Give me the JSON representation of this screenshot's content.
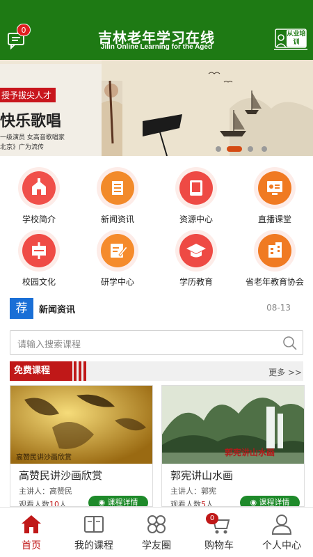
{
  "header": {
    "title": "吉林老年学习在线",
    "subtitle": "Jilin Online Learning for the Aged",
    "message_count": "0",
    "train_label": "从业培训",
    "bg_color": "#1e7a14"
  },
  "banner": {
    "tag": "授予拔尖人才",
    "headline": "快乐歌唱",
    "sub_line_1": "一级演员 女高音歌唱家",
    "sub_line_2": "北京》广为流传",
    "slide_count": 4,
    "active_slide": 2
  },
  "features": [
    {
      "label": "学校简介",
      "icon": "school-icon",
      "color": "#f0504a"
    },
    {
      "label": "新闻资讯",
      "icon": "news-icon",
      "color": "#f28a2a"
    },
    {
      "label": "资源中心",
      "icon": "book-icon",
      "color": "#ee4a44"
    },
    {
      "label": "直播课堂",
      "icon": "live-class-icon",
      "color": "#f07a22"
    },
    {
      "label": "校园文化",
      "icon": "culture-icon",
      "color": "#ef4b45"
    },
    {
      "label": "研学中心",
      "icon": "study-edit-icon",
      "color": "#f58b2c"
    },
    {
      "label": "学历教育",
      "icon": "graduation-cap-icon",
      "color": "#ee4a44"
    },
    {
      "label": "省老年教育协会",
      "icon": "building-icon",
      "color": "#f07a22"
    }
  ],
  "news": {
    "badge": "荐",
    "title": "新闻资讯",
    "date": "08-13"
  },
  "search": {
    "placeholder": "请输入搜索课程"
  },
  "free_courses": {
    "label": "免费课程",
    "more": "更多 >>",
    "courses": [
      {
        "title": "高赞民讲沙画欣赏",
        "lecturer": "主讲人：高赞民",
        "views_label": "观看人数",
        "views": "10",
        "views_unit": "人",
        "button": "课程详情",
        "image_caption": "高赞民讲沙画欣赏"
      },
      {
        "title": "郭宪讲山水画",
        "lecturer": "主讲人：郭宪",
        "views_label": "观看人数",
        "views": "5",
        "views_unit": "人",
        "button": "课程详情",
        "image_caption": "郭宪讲山水画"
      }
    ]
  },
  "tabbar": {
    "items": [
      {
        "label": "首页",
        "icon": "home-icon",
        "active": true
      },
      {
        "label": "我的课程",
        "icon": "my-courses-icon",
        "active": false
      },
      {
        "label": "学友圈",
        "icon": "circle-icon",
        "active": false
      },
      {
        "label": "购物车",
        "icon": "cart-icon",
        "active": false
      },
      {
        "label": "个人中心",
        "icon": "profile-icon",
        "active": false
      }
    ],
    "cart_count": "0",
    "active_color": "#c01818"
  }
}
